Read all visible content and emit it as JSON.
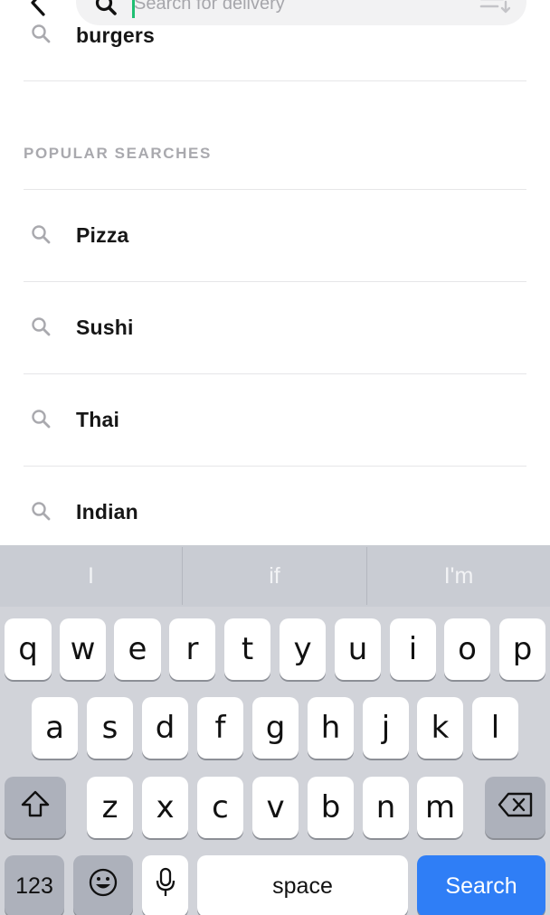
{
  "search_bar": {
    "placeholder": "Search for delivery"
  },
  "recent": {
    "item": "burgers"
  },
  "popular": {
    "heading": "POPULAR SEARCHES",
    "items": [
      "Pizza",
      "Sushi",
      "Thai",
      "Indian"
    ]
  },
  "keyboard": {
    "suggestions": [
      "I",
      "if",
      "I'm"
    ],
    "row1": [
      "q",
      "w",
      "e",
      "r",
      "t",
      "y",
      "u",
      "i",
      "o",
      "p"
    ],
    "row2": [
      "a",
      "s",
      "d",
      "f",
      "g",
      "h",
      "j",
      "k",
      "l"
    ],
    "row3": [
      "z",
      "x",
      "c",
      "v",
      "b",
      "n",
      "m"
    ],
    "numbers_label": "123",
    "space_label": "space",
    "search_label": "Search"
  },
  "colors": {
    "accent_caret": "#1fbf73",
    "search_key": "#2f7ef6",
    "heading_gray": "#a9a9ae"
  },
  "icons": {
    "back": "chevron-left-icon",
    "search": "magnifier-icon",
    "filter": "sort-lines-icon",
    "shift": "shift-arrow-icon",
    "delete": "backspace-icon",
    "emoji": "smiley-icon",
    "mic": "microphone-icon"
  }
}
